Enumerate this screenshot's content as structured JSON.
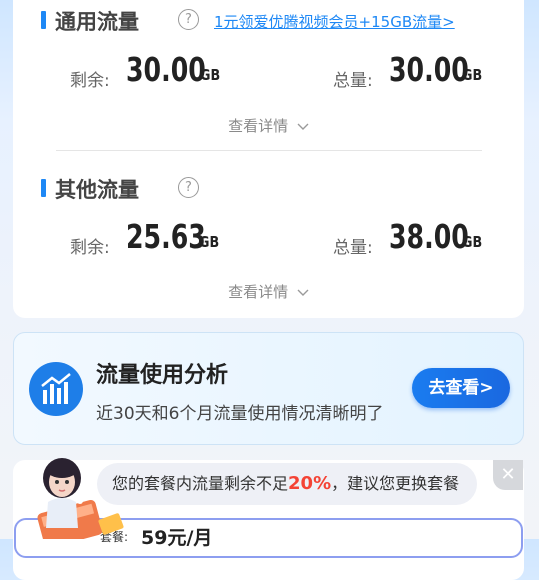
{
  "general": {
    "title": "通用流量",
    "promo_link": "1元领爱优腾视频会员+15GB流量>",
    "remaining_label": "剩余:",
    "remaining_value": "30.00",
    "remaining_unit": "GB",
    "total_label": "总量:",
    "total_value": "30.00",
    "total_unit": "GB",
    "details_label": "查看详情"
  },
  "other": {
    "title": "其他流量",
    "remaining_label": "剩余:",
    "remaining_value": "25.63",
    "remaining_unit": "GB",
    "total_label": "总量:",
    "total_value": "38.00",
    "total_unit": "GB",
    "details_label": "查看详情"
  },
  "analysis": {
    "title": "流量使用分析",
    "subtitle": "近30天和6个月流量使用情况清晰明了",
    "button_label": "去查看>"
  },
  "plan": {
    "notice_before": "您的套餐内流量剩余不足",
    "notice_highlight": "20%",
    "notice_after": "，建议您更换套餐",
    "plan_label": "套餐:",
    "plan_price": "59元/月"
  },
  "icons": {
    "help": "question-circle-icon",
    "chevron": "chevron-down-icon",
    "analysis": "chart-bars-icon",
    "close": "close-icon"
  },
  "colors": {
    "accent": "#1e88f5",
    "highlight": "#f44335"
  }
}
